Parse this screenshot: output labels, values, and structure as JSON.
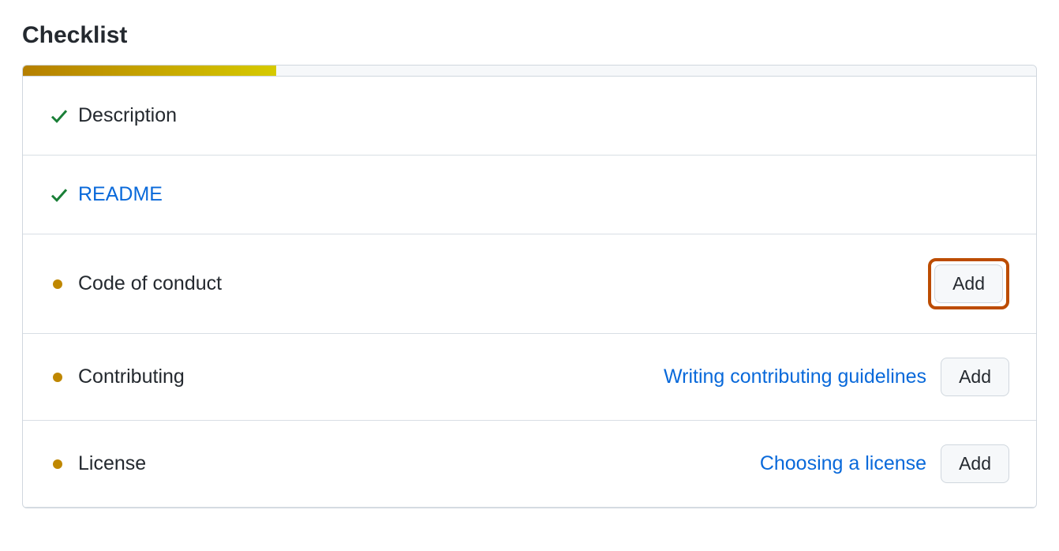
{
  "title": "Checklist",
  "progress_percent": 25,
  "add_label": "Add",
  "items": [
    {
      "status": "done",
      "label": "Description",
      "is_link": false
    },
    {
      "status": "done",
      "label": "README",
      "is_link": true
    },
    {
      "status": "pending",
      "label": "Code of conduct",
      "help_text": null,
      "has_add": true,
      "highlighted": true
    },
    {
      "status": "pending",
      "label": "Contributing",
      "help_text": "Writing contributing guidelines",
      "has_add": true,
      "highlighted": false
    },
    {
      "status": "pending",
      "label": "License",
      "help_text": "Choosing a license",
      "has_add": true,
      "highlighted": false
    }
  ]
}
